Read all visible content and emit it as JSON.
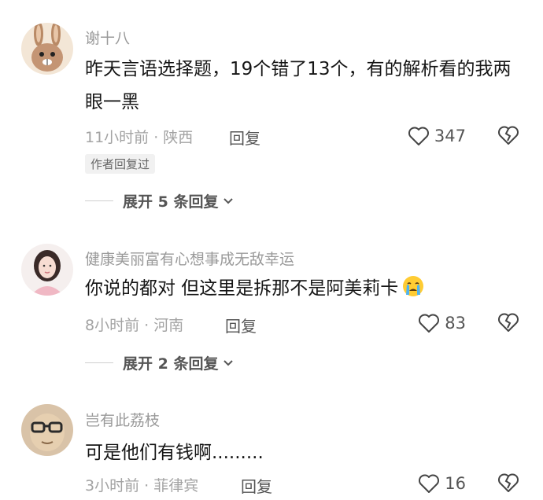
{
  "comments": [
    {
      "username": "谢十八",
      "text": "昨天言语选择题，19个错了13个，有的解析看的我两眼一黑",
      "meta": "11小时前 · 陕西",
      "reply_label": "回复",
      "likes": "347",
      "author_badge": "作者回复过",
      "expand_label": "展开 5 条回复",
      "avatar_icon": "rabbit-avatar-icon"
    },
    {
      "username": "健康美丽富有心想事成无敌幸运",
      "text": "你说的都对 但这里是拆那不是阿美莉卡",
      "emoji": "crying-face-emoji",
      "meta": "8小时前 · 河南",
      "reply_label": "回复",
      "likes": "83",
      "expand_label": "展开 2 条回复",
      "avatar_icon": "woman-portrait-avatar-icon"
    },
    {
      "username": "岂有此荔枝",
      "text": "可是他们有钱啊.........",
      "meta": "3小时前 · 菲律宾",
      "reply_label": "回复",
      "likes": "16",
      "avatar_icon": "glasses-character-avatar-icon"
    }
  ],
  "colors": {
    "username": "#9a9a9a",
    "body_text": "#161616",
    "meta": "#a3a3a3",
    "badge_bg": "#f1f1f1"
  }
}
